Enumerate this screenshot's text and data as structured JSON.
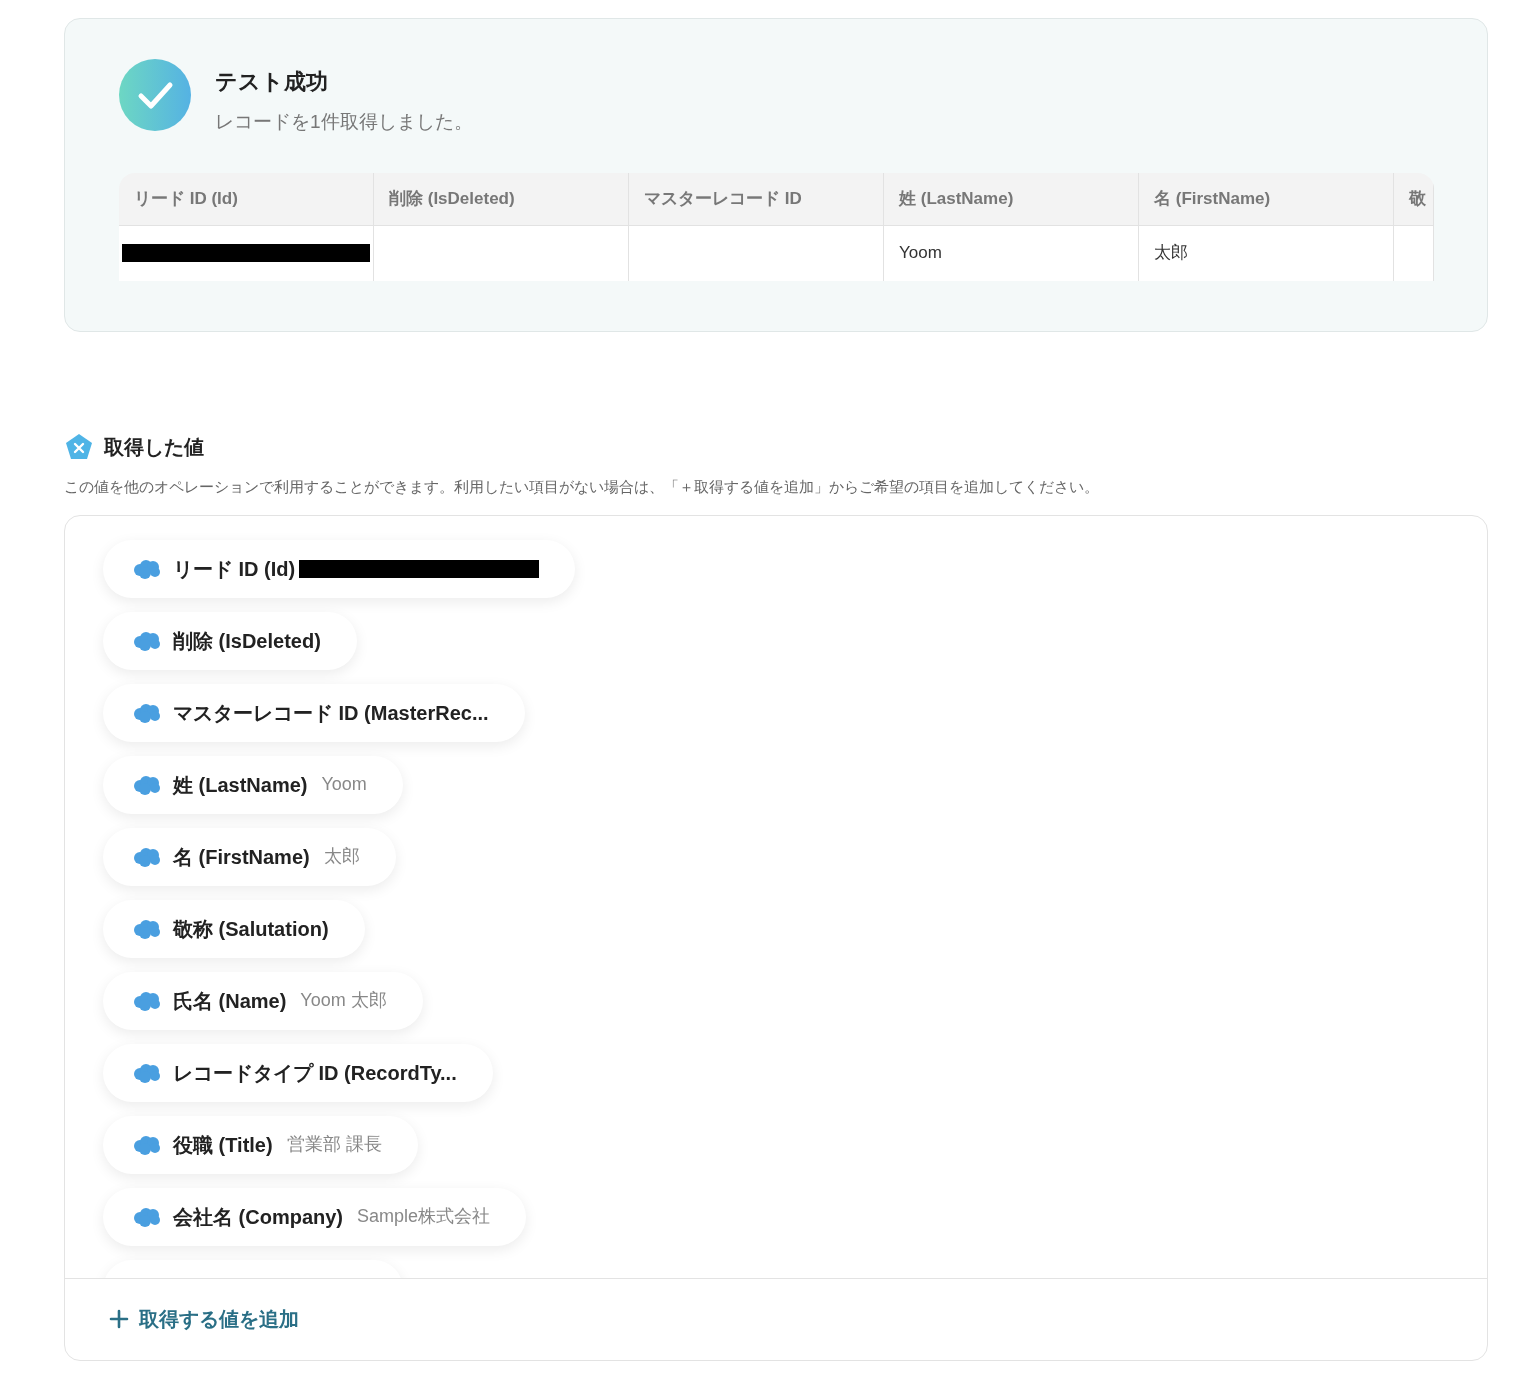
{
  "result": {
    "title": "テスト成功",
    "message": "レコードを1件取得しました。",
    "table": {
      "columns": [
        "リード ID (Id)",
        "削除 (IsDeleted)",
        "マスターレコード ID",
        "姓 (LastName)",
        "名 (FirstName)",
        "敬"
      ],
      "rows": [
        {
          "cells": [
            {
              "text": "",
              "redacted": true
            },
            {
              "text": "",
              "redacted": false
            },
            {
              "text": "",
              "redacted": false
            },
            {
              "text": "Yoom",
              "redacted": false
            },
            {
              "text": "太郎",
              "redacted": false
            },
            {
              "text": "",
              "redacted": false
            }
          ]
        }
      ]
    }
  },
  "values_section": {
    "title": "取得した値",
    "description": "この値を他のオペレーションで利用することができます。利用したい項目がない場合は、「＋取得する値を追加」からご希望の項目を追加してください。",
    "items": [
      {
        "kind": "field",
        "label": "リード ID (Id)",
        "value": "",
        "redacted": true
      },
      {
        "kind": "field",
        "label": "削除 (IsDeleted)",
        "value": "",
        "redacted": false
      },
      {
        "kind": "field",
        "label": "マスターレコード ID (MasterRec...",
        "value": "",
        "redacted": false
      },
      {
        "kind": "field",
        "label": "姓 (LastName)",
        "value": "Yoom",
        "redacted": false
      },
      {
        "kind": "field",
        "label": "名 (FirstName)",
        "value": "太郎",
        "redacted": false
      },
      {
        "kind": "field",
        "label": "敬称 (Salutation)",
        "value": "",
        "redacted": false
      },
      {
        "kind": "field",
        "label": "氏名 (Name)",
        "value": "Yoom 太郎",
        "redacted": false
      },
      {
        "kind": "field",
        "label": "レコードタイプ ID (RecordTy...",
        "value": "",
        "redacted": false
      },
      {
        "kind": "field",
        "label": "役職 (Title)",
        "value": "営業部 課長",
        "redacted": false
      },
      {
        "kind": "field",
        "label": "会社名 (Company)",
        "value": "Sample株式会社",
        "redacted": false
      },
      {
        "kind": "clipped"
      }
    ],
    "add_button": {
      "label": "取得する値を追加"
    }
  }
}
